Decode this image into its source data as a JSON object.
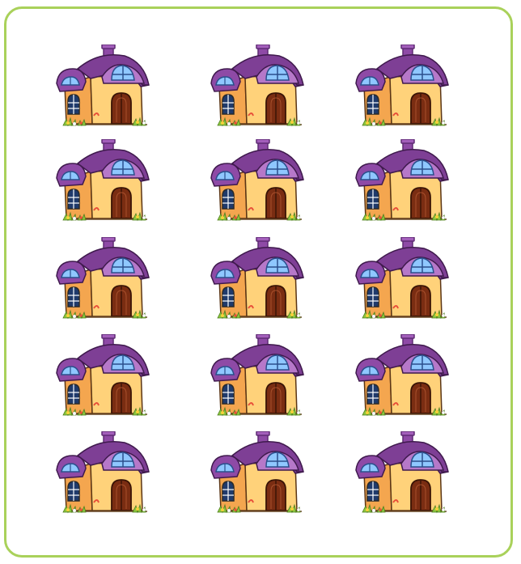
{
  "colors": {
    "frame_border": "#a9d15a",
    "roof": "#7e3f95",
    "roof_dark": "#5f2b74",
    "roof_light": "#b678c9",
    "wall_front": "#ffd27a",
    "wall_side": "#f4a64f",
    "door": "#7a2d12",
    "window_glass": "#8fc7ff",
    "grass": "#8cc63f",
    "flower_red": "#e8503a",
    "flower_yellow": "#f7d23a"
  },
  "grid": {
    "rows": 5,
    "cols": 3
  },
  "houses": [
    {
      "icon": "house-icon"
    },
    {
      "icon": "house-icon"
    },
    {
      "icon": "house-icon"
    },
    {
      "icon": "house-icon"
    },
    {
      "icon": "house-icon"
    },
    {
      "icon": "house-icon"
    },
    {
      "icon": "house-icon"
    },
    {
      "icon": "house-icon"
    },
    {
      "icon": "house-icon"
    },
    {
      "icon": "house-icon"
    },
    {
      "icon": "house-icon"
    },
    {
      "icon": "house-icon"
    },
    {
      "icon": "house-icon"
    },
    {
      "icon": "house-icon"
    },
    {
      "icon": "house-icon"
    }
  ]
}
